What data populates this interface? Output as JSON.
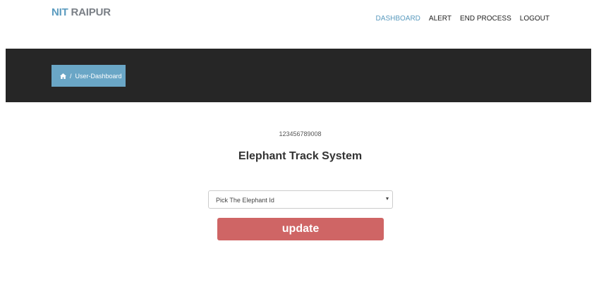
{
  "header": {
    "brand_part1": "NIT",
    "brand_part2": " RAIPUR",
    "nav": {
      "dashboard": "DASHBOARD",
      "alert": "ALERT",
      "end_process": "END PROCESS",
      "logout": "LOGOUT"
    }
  },
  "breadcrumb": {
    "separator": "/",
    "current": "User-Dashboard"
  },
  "main": {
    "user_id": "123456789008",
    "title": "Elephant Track System",
    "select_placeholder": "Pick The Elephant Id",
    "update_label": "update"
  },
  "icons": {
    "home": "home-icon",
    "caret": "caret-down-icon"
  },
  "colors": {
    "accent": "#5b9bbf",
    "band": "#262626",
    "button": "#cf6565"
  }
}
